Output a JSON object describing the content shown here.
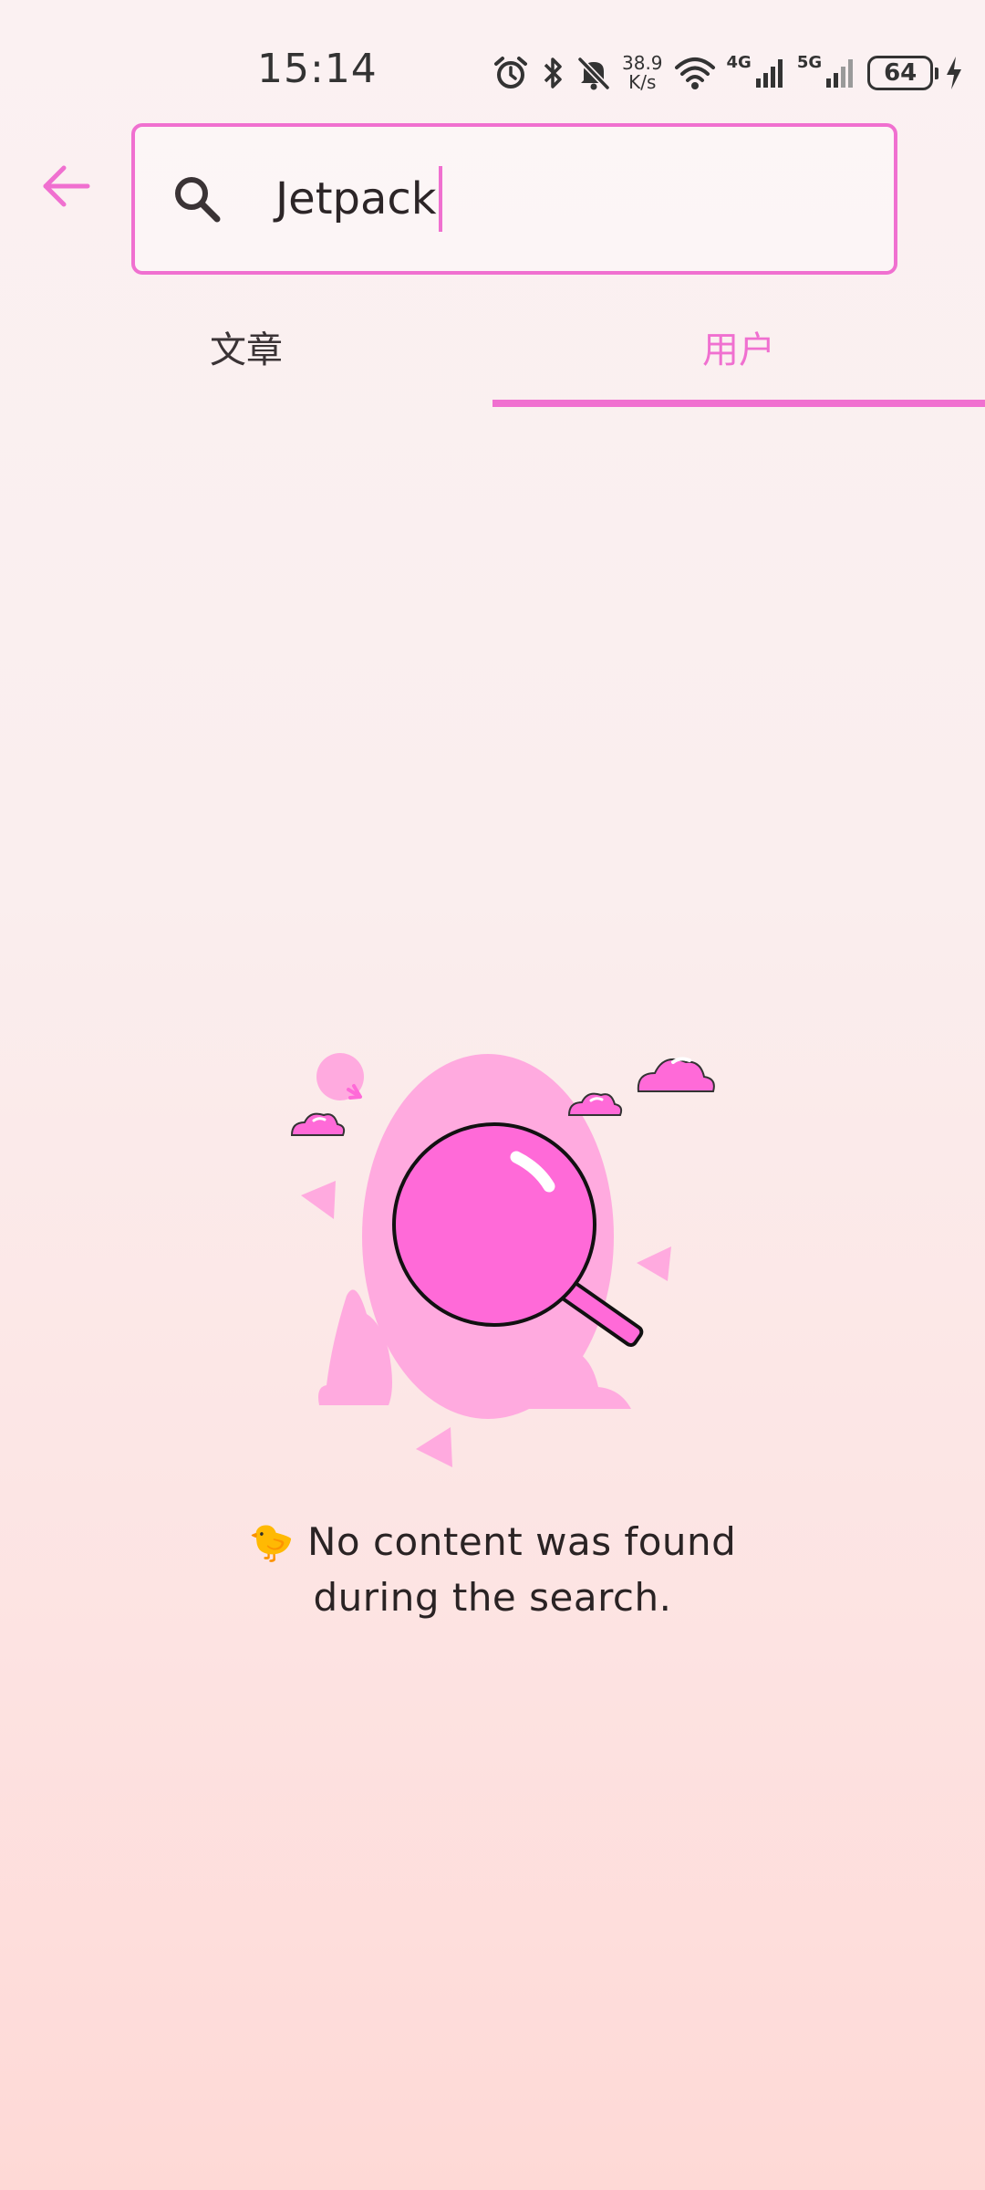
{
  "status_bar": {
    "time": "15:14",
    "net_speed_value": "38.9",
    "net_speed_unit": "K/s",
    "network_4g": "4G",
    "network_5g": "5G",
    "battery_level": "64"
  },
  "search": {
    "query": "Jetpack"
  },
  "tabs": [
    {
      "label": "文章"
    },
    {
      "label": "用户"
    }
  ],
  "empty_state": {
    "emoji": "🐤",
    "message_line1": "No content was found",
    "message_line2": "during the search."
  },
  "colors": {
    "accent": "#f070d0",
    "illustration_pink": "#ff6ad8",
    "illustration_light": "#ffaadf"
  }
}
